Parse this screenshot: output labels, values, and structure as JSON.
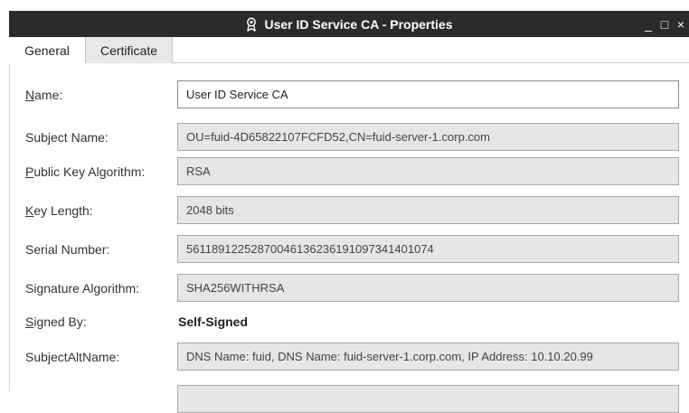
{
  "window": {
    "title": "User ID Service CA - Properties",
    "icon": "certificate-ribbon-icon",
    "controls": {
      "minimize": "_",
      "maximize": "□",
      "close": "×"
    },
    "colors": {
      "titlebar_bg": "#2b2b2b",
      "titlebar_fg": "#ffffff"
    }
  },
  "tabs": [
    {
      "label": "General",
      "active": true
    },
    {
      "label": "Certificate",
      "active": false
    }
  ],
  "fields": {
    "name": {
      "label_mnemonic": "N",
      "label_rest": "ame:",
      "value": "User ID Service CA"
    },
    "subject_name": {
      "label": "Subject Name:",
      "value": "OU=fuid-4D65822107FCFD52,CN=fuid-server-1.corp.com"
    },
    "public_key_algorithm": {
      "label_mnemonic": "P",
      "label_rest": "ublic Key Algorithm:",
      "value": "RSA"
    },
    "key_length": {
      "label_mnemonic": "K",
      "label_rest": "ey Length:",
      "value": "2048 bits"
    },
    "serial_number": {
      "label": "Serial Number:",
      "value": "56118912252870046136236191097341401074"
    },
    "signature_algorithm": {
      "label": "Signature Algorithm:",
      "value": "SHA256WITHRSA"
    },
    "signed_by": {
      "label_mnemonic": "S",
      "label_rest": "igned By:",
      "value": "Self-Signed"
    },
    "subject_alt_name": {
      "label": "SubjectAltName:",
      "value": "DNS Name: fuid, DNS Name: fuid-server-1.corp.com, IP Address: 10.10.20.99"
    }
  }
}
